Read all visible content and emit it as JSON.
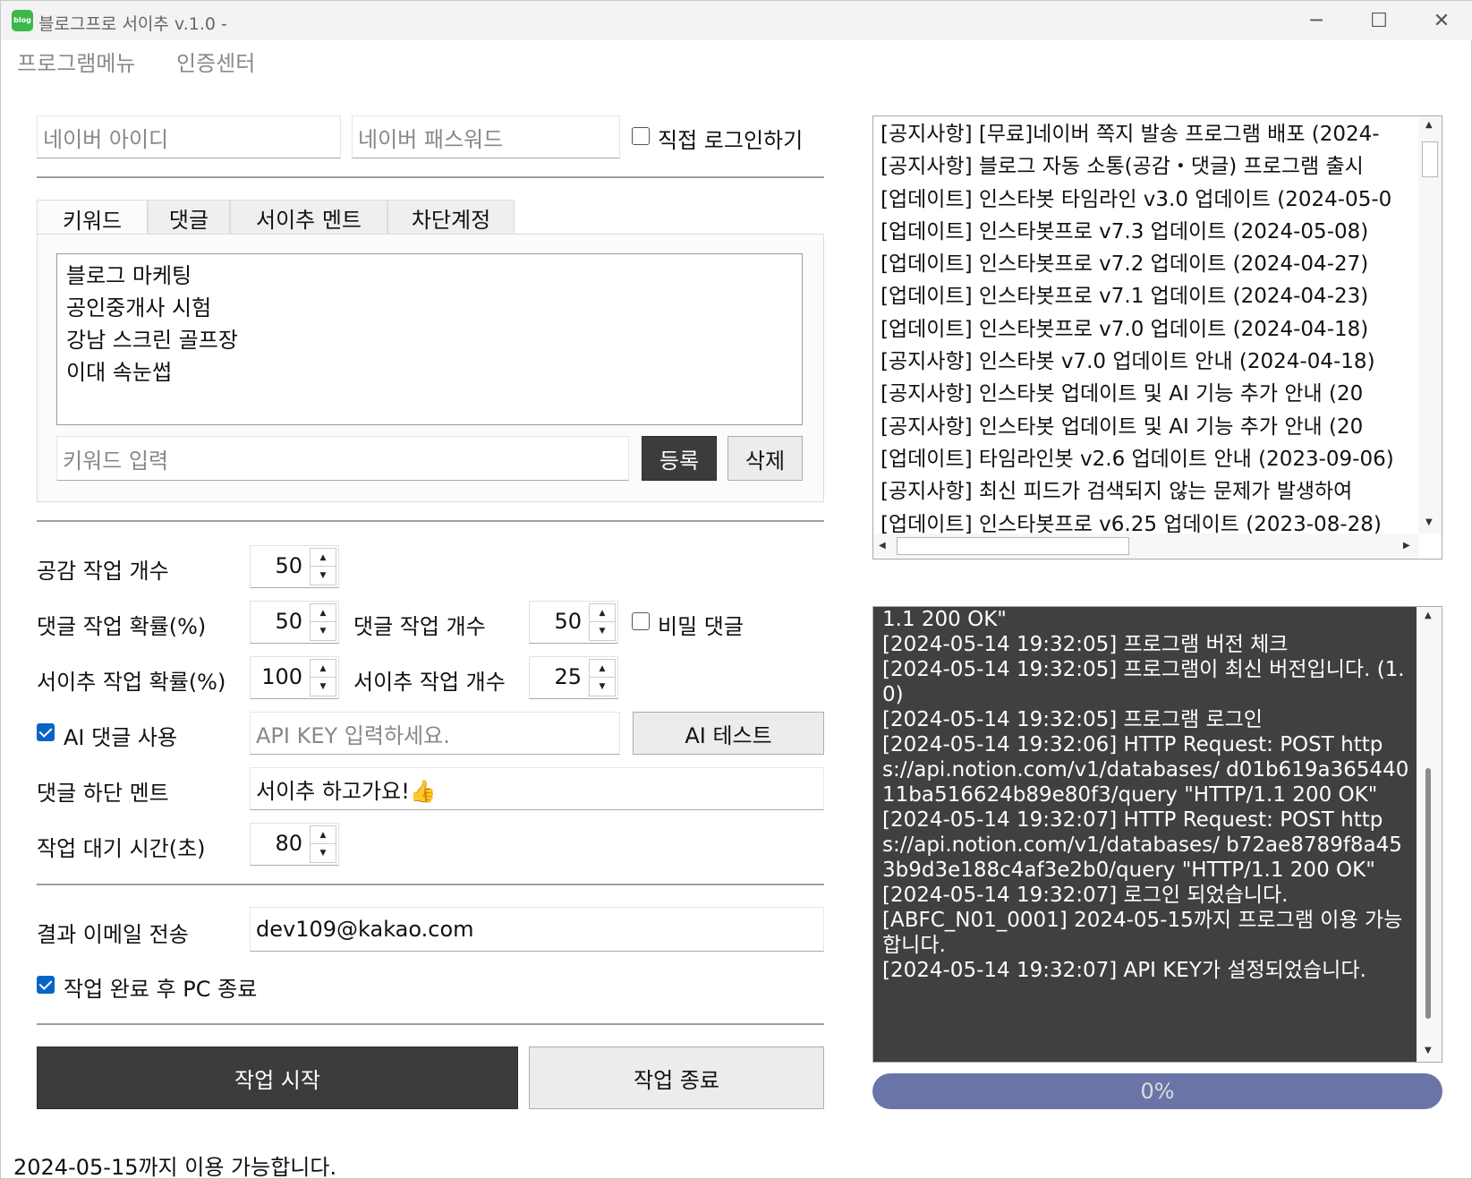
{
  "window": {
    "title": "블로그프로 서이추 v.1.0 -",
    "icon_label": "blog",
    "minimize": "─",
    "maximize": "☐",
    "close": "✕"
  },
  "menu": {
    "items": [
      "프로그램메뉴",
      "인증센터"
    ]
  },
  "login": {
    "id_placeholder": "네이버 아이디",
    "pw_placeholder": "네이버 패스워드",
    "direct_login_label": "직접 로그인하기",
    "direct_login_checked": false
  },
  "tabs": [
    {
      "label": "키워드",
      "active": true
    },
    {
      "label": "댓글",
      "active": false
    },
    {
      "label": "서이추 멘트",
      "active": false
    },
    {
      "label": "차단계정",
      "active": false
    }
  ],
  "keywords": {
    "items": [
      "블로그 마케팅",
      "공인중개사 시험",
      "강남 스크린 골프장",
      "이대 속눈썹"
    ],
    "input_placeholder": "키워드 입력",
    "register_label": "등록",
    "delete_label": "삭제"
  },
  "settings": {
    "like_count_label": "공감 작업 개수",
    "like_count": "50",
    "comment_prob_label": "댓글 작업 확률(%)",
    "comment_prob": "50",
    "comment_count_label": "댓글 작업 개수",
    "comment_count": "50",
    "secret_comment_label": "비밀 댓글",
    "secret_comment_checked": false,
    "neighbor_prob_label": "서이추 작업 확률(%)",
    "neighbor_prob": "100",
    "neighbor_count_label": "서이추 작업 개수",
    "neighbor_count": "25",
    "ai_comment_label": "AI 댓글 사용",
    "ai_comment_checked": true,
    "api_key_placeholder": "API KEY 입력하세요.",
    "ai_test_label": "AI 테스트",
    "footer_ment_label": "댓글 하단 멘트",
    "footer_ment": "서이추 하고가요!👍",
    "wait_time_label": "작업 대기 시간(초)",
    "wait_time": "80",
    "email_label": "결과 이메일 전송",
    "email": "dev109@kakao.com",
    "shutdown_label": "작업 완료 후 PC 종료",
    "shutdown_checked": true
  },
  "actions": {
    "start_label": "작업 시작",
    "stop_label": "작업 종료"
  },
  "notices": [
    "[공지사항] [무료]네이버 쪽지 발송 프로그램 배포 (2024-",
    "[공지사항] 블로그 자동 소통(공감・댓글) 프로그램 출시",
    "[업데이트] 인스타봇 타임라인 v3.0 업데이트 (2024-05-0",
    "[업데이트] 인스타봇프로 v7.3 업데이트 (2024-05-08)",
    "[업데이트] 인스타봇프로 v7.2 업데이트 (2024-04-27)",
    "[업데이트] 인스타봇프로 v7.1 업데이트 (2024-04-23)",
    "[업데이트] 인스타봇프로 v7.0 업데이트 (2024-04-18)",
    "[공지사항] 인스타봇 v7.0 업데이트 안내 (2024-04-18)",
    "[공지사항] 인스타봇 업데이트 및 AI 기능 추가 안내 (20",
    "[공지사항] 인스타봇 업데이트 및 AI 기능 추가 안내 (20",
    "[업데이트] 타임라인봇 v2.6 업데이트 안내 (2023-09-06)",
    "[공지사항] 최신 피드가 검색되지 않는 문제가 발생하여",
    "[업데이트] 인스타봇프로 v6.25 업데이트 (2023-08-28)"
  ],
  "log": [
    "1.1 200 OK\"",
    "[2024-05-14 19:32:05] 프로그램 버전 체크",
    "[2024-05-14 19:32:05] 프로그램이 최신 버전입니다. (1.0)",
    "[2024-05-14 19:32:05] 프로그램 로그인",
    "[2024-05-14 19:32:06] HTTP Request: POST https://api.notion.com/v1/databases/ d01b619a36544011ba516624b89e80f3/query \"HTTP/1.1 200 OK\"",
    "[2024-05-14 19:32:07] HTTP Request: POST https://api.notion.com/v1/databases/ b72ae8789f8a453b9d3e188c4af3e2b0/query \"HTTP/1.1 200 OK\"",
    "[2024-05-14 19:32:07] 로그인 되었습니다.",
    "[ABFC_N01_0001] 2024-05-15까지 프로그램 이용 가능합니다.",
    "[2024-05-14 19:32:07] API KEY가 설정되었습니다."
  ],
  "progress": {
    "value": 0,
    "label": "0%"
  },
  "status": "2024-05-15까지 이용 가능합니다."
}
